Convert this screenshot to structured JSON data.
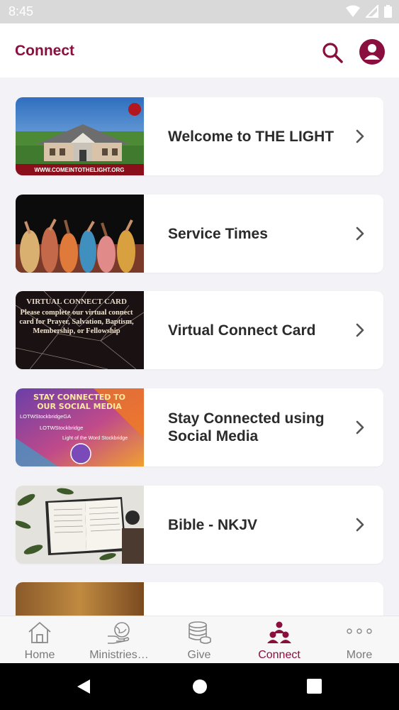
{
  "status_bar": {
    "time": "8:45"
  },
  "app_bar": {
    "title": "Connect"
  },
  "colors": {
    "brand": "#8b0f3e",
    "inactive": "#7a7a7a",
    "background": "#f2f2f7"
  },
  "thumb_texts": {
    "welcome": "WWW.COMEINTOTHELIGHT.ORG",
    "virtual_heading": "VIRTUAL CONNECT CARD",
    "virtual_body": "Please complete our virtual connect card for Prayer, Salvation, Baptism, Membership, or Fellowship",
    "social_heading": "STAY CONNECTED TO OUR SOCIAL MEDIA",
    "social_fb": "LOTWStockbridgeGA",
    "social_ig": "LOTWStockbridge",
    "social_yt": "Light of the Word Stockbridge"
  },
  "cards": [
    {
      "title": "Welcome to THE LIGHT"
    },
    {
      "title": "Service Times"
    },
    {
      "title": "Virtual Connect Card"
    },
    {
      "title": "Stay Connected using Social Media"
    },
    {
      "title": "Bible - NKJV"
    },
    {
      "title": ""
    }
  ],
  "bottom_nav": {
    "home": "Home",
    "ministries": "Ministries…",
    "give": "Give",
    "connect": "Connect",
    "more": "More"
  }
}
